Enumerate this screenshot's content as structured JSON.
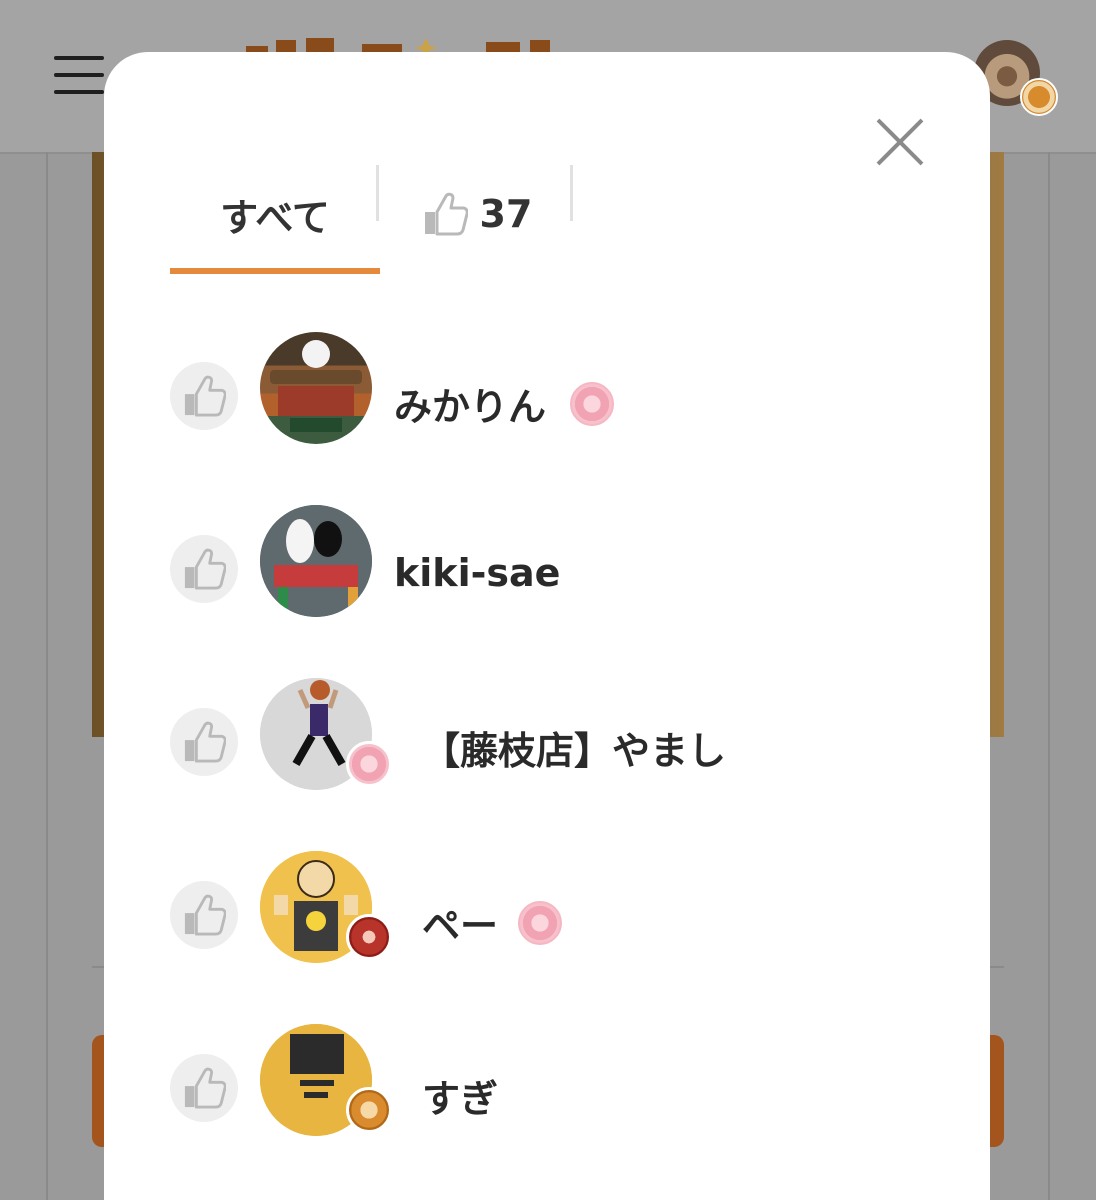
{
  "modal": {
    "tabs": [
      {
        "label": "すべて",
        "active": true
      },
      {
        "label": "37",
        "icon": "thumbs-up-icon"
      }
    ],
    "users": [
      {
        "name": "みかりん",
        "badge": "pink"
      },
      {
        "name": "kiki-sae"
      },
      {
        "name": "【藤枝店】やまし",
        "avatar_badge": "pink"
      },
      {
        "name": "ペー",
        "avatar_badge": "red",
        "badge": "pink"
      },
      {
        "name": "すぎ",
        "avatar_badge": "gold"
      }
    ]
  },
  "colors": {
    "accent": "#e38a3d",
    "overlay": "#9a9a9a",
    "thumb": "#b9b9b9"
  }
}
